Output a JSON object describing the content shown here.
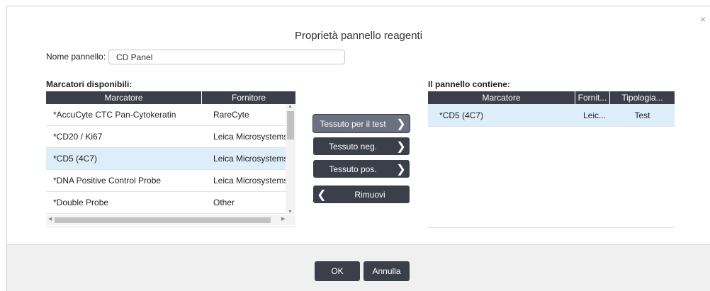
{
  "dialog": {
    "title": "Proprietà pannello reagenti",
    "close_label": "×",
    "name_label": "Nome pannello:",
    "name_value": "CD Panel"
  },
  "available": {
    "label": "Marcatori disponibili:",
    "columns": [
      "Marcatore",
      "Fornitore"
    ],
    "rows": [
      {
        "marker": "*AccuCyte CTC Pan-Cytokeratin",
        "supplier": "RareCyte"
      },
      {
        "marker": "*CD20 / Ki67",
        "supplier": "Leica Microsystems"
      },
      {
        "marker": "*CD5 (4C7)",
        "supplier": "Leica Microsystems"
      },
      {
        "marker": "*DNA Positive Control Probe",
        "supplier": "Leica Microsystems"
      },
      {
        "marker": "*Double Probe",
        "supplier": "Other"
      }
    ],
    "selected_index": 2
  },
  "actions": {
    "test_tissue": "Tessuto per il test",
    "neg_tissue": "Tessuto neg.",
    "pos_tissue": "Tessuto pos.",
    "remove": "Rimuovi"
  },
  "contains": {
    "label": "Il pannello contiene:",
    "columns": [
      "Marcatore",
      "Fornit...",
      "Tipologia..."
    ],
    "rows": [
      {
        "marker": "*CD5 (4C7)",
        "supplier": "Leic...",
        "type": "Test"
      }
    ]
  },
  "footer": {
    "ok": "OK",
    "cancel": "Annulla"
  },
  "colors": {
    "header_bg": "#3b3f4a",
    "selected_row": "#ddeefa",
    "footer_bg": "#f0f0f0"
  }
}
